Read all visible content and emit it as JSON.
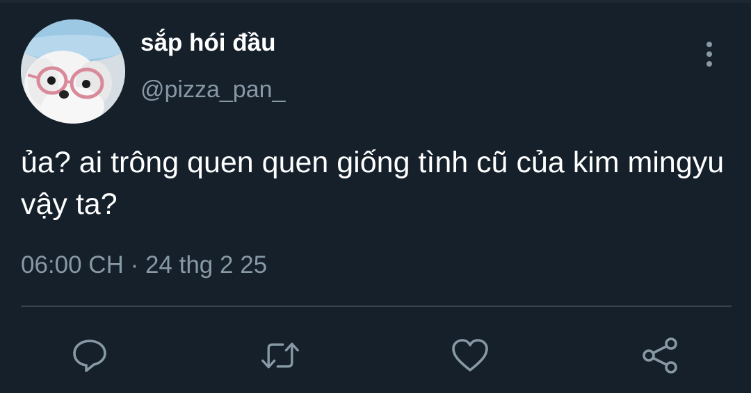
{
  "user": {
    "display_name": "sắp hói đầu",
    "handle": "@pizza_pan_"
  },
  "tweet": {
    "text": "ủa? ai trông quen quen giống tình cũ của kim mingyu vậy ta?",
    "timestamp": "06:00 CH · 24 thg 2 25"
  },
  "icons": {
    "more": "more-vertical-icon",
    "reply": "reply-icon",
    "retweet": "retweet-icon",
    "like": "heart-icon",
    "share": "share-icon"
  },
  "colors": {
    "background": "#15202b",
    "primary_text": "#ffffff",
    "secondary_text": "#8899a6",
    "divider": "#38444d"
  }
}
